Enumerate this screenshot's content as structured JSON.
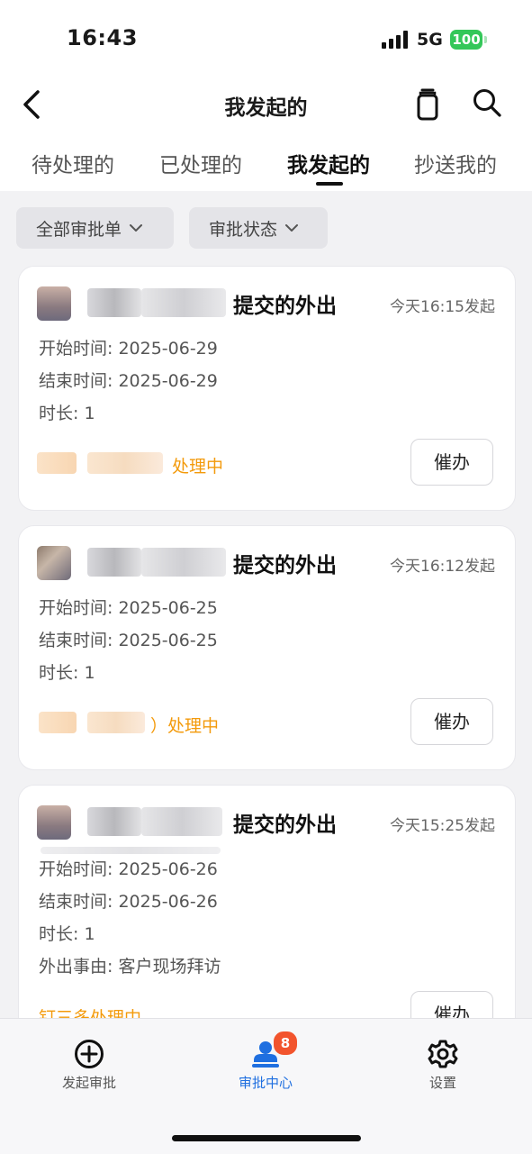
{
  "status_bar": {
    "time": "16:43",
    "network": "5G",
    "battery": "100"
  },
  "nav": {
    "title": "我发起的"
  },
  "tabs": [
    {
      "label": "待处理的",
      "active": false
    },
    {
      "label": "已处理的",
      "active": false
    },
    {
      "label": "我发起的",
      "active": true
    },
    {
      "label": "抄送我的",
      "active": false
    }
  ],
  "filters": [
    {
      "label": "全部审批单"
    },
    {
      "label": "审批状态"
    }
  ],
  "cards": [
    {
      "title": "提交的外出",
      "when": "今天16:15发起",
      "lines": [
        "开始时间: 2025-06-29",
        "结束时间: 2025-06-29",
        "时长: 1"
      ],
      "status": "处理中",
      "button": "催办"
    },
    {
      "title": "提交的外出",
      "when": "今天16:12发起",
      "lines": [
        "开始时间: 2025-06-25",
        "结束时间: 2025-06-25",
        "时长: 1"
      ],
      "status": "）处理中",
      "button": "催办"
    },
    {
      "title": "提交的外出",
      "when": "今天15:25发起",
      "lines": [
        "开始时间: 2025-06-26",
        "结束时间: 2025-06-26",
        "时长: 1",
        "外出事由: 客户现场拜访"
      ],
      "status": "钉三多处理中",
      "button": "催办"
    }
  ],
  "tabbar": [
    {
      "label": "发起审批",
      "icon": "plus-circle-icon"
    },
    {
      "label": "审批中心",
      "icon": "user-stamp-icon",
      "badge": "8",
      "active": true
    },
    {
      "label": "设置",
      "icon": "gear-icon"
    }
  ],
  "colors": {
    "accent": "#1f6fe0",
    "status": "#f39a0b",
    "badge": "#f2542d",
    "battery": "#34c759"
  }
}
